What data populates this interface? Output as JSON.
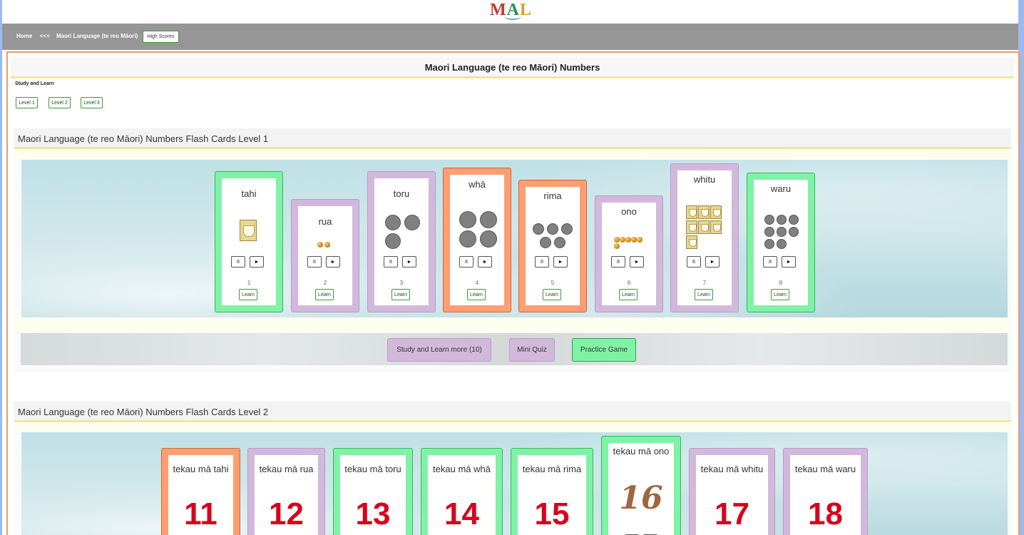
{
  "logo": {
    "m": "M",
    "a": "A",
    "l": "L"
  },
  "nav": {
    "home": "Home",
    "back": "<<<",
    "language": "Maori Language (te reo Māori)",
    "high_scores": "High Scores"
  },
  "page_title": "Maori Language (te reo Māori) Numbers",
  "study": {
    "label": "Study and Learn",
    "levels": [
      "Level 1",
      "Level 2",
      "Level 3"
    ]
  },
  "level1": {
    "title": "Maori Language (te reo Māori) Numbers Flash Cards Level 1",
    "cards": [
      {
        "word": "tahi",
        "number": "1",
        "color": "green"
      },
      {
        "word": "rua",
        "number": "2",
        "color": "lilac"
      },
      {
        "word": "toru",
        "number": "3",
        "color": "lilac"
      },
      {
        "word": "whā",
        "number": "4",
        "color": "orange"
      },
      {
        "word": "rima",
        "number": "5",
        "color": "orange"
      },
      {
        "word": "ono",
        "number": "6",
        "color": "lilac"
      },
      {
        "word": "whitu",
        "number": "7",
        "color": "lilac"
      },
      {
        "word": "waru",
        "number": "8",
        "color": "green"
      }
    ],
    "pause": "II",
    "play": "►",
    "learn": "Learn",
    "actions": {
      "study_more": "Study and Learn more (10)",
      "quiz": "Mini Quiz",
      "game": "Practice Game"
    }
  },
  "level2": {
    "title": "Maori Language (te reo Māori) Numbers Flash Cards Level 2",
    "cards": [
      {
        "word": "tekau mā tahi",
        "number": "11",
        "color": "orange"
      },
      {
        "word": "tekau mā rua",
        "number": "12",
        "color": "lilac"
      },
      {
        "word": "tekau mā toru",
        "number": "13",
        "color": "green"
      },
      {
        "word": "tekau mā whā",
        "number": "14",
        "color": "green"
      },
      {
        "word": "tekau mā rima",
        "number": "15",
        "color": "green"
      },
      {
        "word": "tekau mā ono",
        "number": "16",
        "color": "green"
      },
      {
        "word": "tekau mā whitu",
        "number": "17",
        "color": "lilac"
      },
      {
        "word": "tekau mā waru",
        "number": "18",
        "color": "lilac"
      }
    ]
  }
}
